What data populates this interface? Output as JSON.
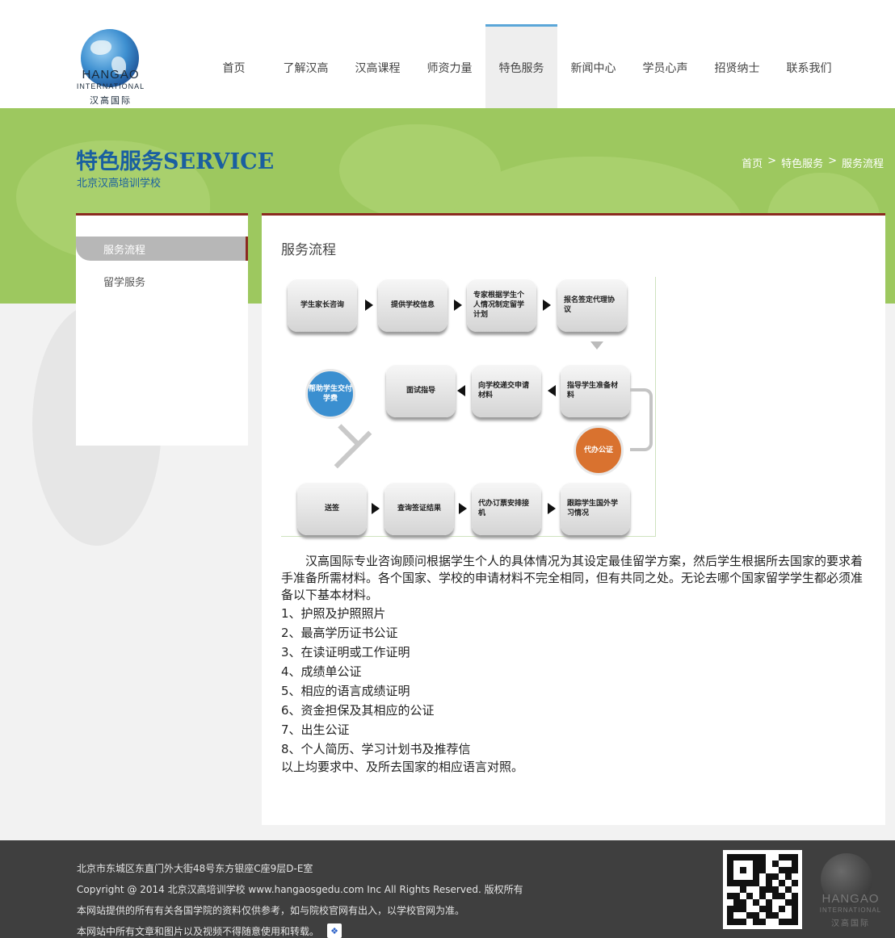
{
  "header": {
    "logo_en": "HANGAO",
    "logo_en2": "INTERNATIONAL",
    "logo_cn": "汉高国际",
    "nav": [
      "首页",
      "了解汉高",
      "汉高课程",
      "师资力量",
      "特色服务",
      "新闻中心",
      "学员心声",
      "招贤纳士",
      "联系我们"
    ],
    "active_nav": "特色服务"
  },
  "banner": {
    "title": "特色服务SERVICE",
    "subtitle": "北京汉高培训学校",
    "breadcrumb": [
      "首页",
      ">",
      "特色服务",
      ">",
      "服务流程"
    ]
  },
  "sidebar": {
    "items": [
      "服务流程",
      "留学服务"
    ],
    "active": "服务流程"
  },
  "content": {
    "title": "服务流程",
    "flow": {
      "row1": [
        "学生家长咨询",
        "提供学校信息",
        "专家根据学生个人情况制定留学计划",
        "报名签定代理协议"
      ],
      "row2": [
        "指导学生准备材料",
        "向学校递交申请材料",
        "面试指导"
      ],
      "circle_blue": "帮助学生交付学费",
      "circle_orange": "代办公证",
      "row3": [
        "送签",
        "查询签证结果",
        "代办订票安排接机",
        "跟踪学生国外学习情况"
      ],
      "colors": {
        "blue": "#3b8fd0",
        "orange": "#d9722f"
      }
    },
    "intro": "汉高国际专业咨询顾问根据学生个人的具体情况为其设定最佳留学方案，然后学生根据所去国家的要求着手准备所需材料。各个国家、学校的申请材料不完全相同，但有共同之处。无论去哪个国家留学学生都必须准备以下基本材料。",
    "list": [
      "1、护照及护照照片",
      "2、最高学历证书公证",
      "3、在读证明或工作证明",
      "4、成绩单公证",
      "5、相应的语言成绩证明",
      "6、资金担保及其相应的公证",
      "7、出生公证",
      "8、个人简历、学习计划书及推荐信"
    ],
    "closing": "以上均要求中、及所去国家的相应语言对照。"
  },
  "footer": {
    "address": "北京市东城区东直门外大街48号东方银座C座9层D-E室",
    "copyright": "Copyright @ 2014 北京汉高培训学校 www.hangaosgedu.com Inc All Rights Reserved. 版权所有",
    "disclaimer1": "本网站提供的所有有关各国学院的资料仅供参考，如与院校官网有出入，以学校官网为准。",
    "disclaimer2": "本网站中所有文章和图片以及视频不得随意使用和转载。",
    "logo_en": "HANGAO",
    "logo_en2": "INTERNATIONAL",
    "logo_cn": "汉高国际"
  }
}
